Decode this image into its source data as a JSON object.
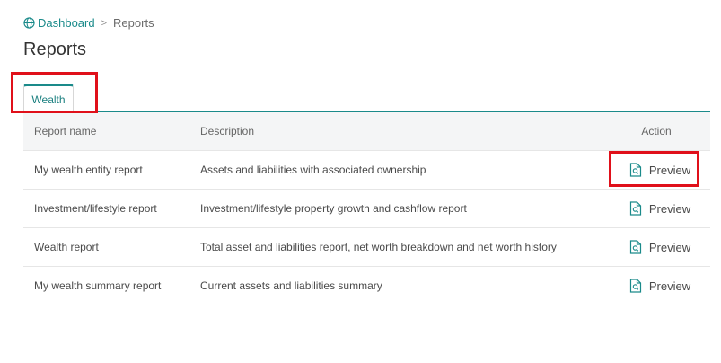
{
  "breadcrumb": {
    "home_label": "Dashboard",
    "separator": ">",
    "current": "Reports"
  },
  "page": {
    "title": "Reports"
  },
  "tabs": [
    {
      "label": "Wealth",
      "active": true
    }
  ],
  "table": {
    "headers": {
      "name": "Report name",
      "description": "Description",
      "action": "Action"
    },
    "rows": [
      {
        "name": "My wealth entity report",
        "description": "Assets and liabilities with associated ownership",
        "action": "Preview"
      },
      {
        "name": "Investment/lifestyle report",
        "description": "Investment/lifestyle property growth and cashflow report",
        "action": "Preview"
      },
      {
        "name": "Wealth report",
        "description": "Total asset and liabilities report, net worth breakdown and net worth history",
        "action": "Preview"
      },
      {
        "name": "My wealth summary report",
        "description": "Current assets and liabilities summary",
        "action": "Preview"
      }
    ]
  },
  "icons": {
    "home": "globe-icon",
    "preview": "document-search-icon"
  },
  "colors": {
    "accent": "#1a8a8a",
    "highlight": "#e0101a",
    "header_bg": "#f4f5f6"
  }
}
